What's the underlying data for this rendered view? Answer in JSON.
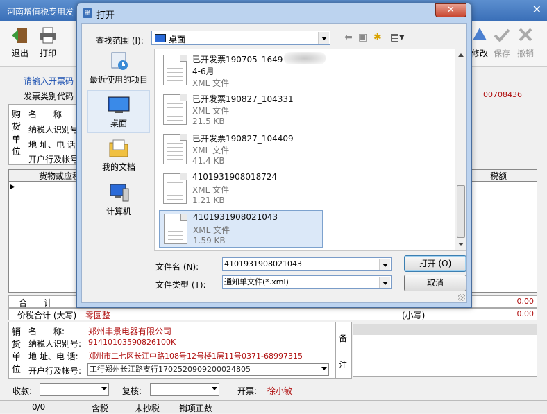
{
  "app": {
    "title": "河南增值税专用发",
    "close": "✕",
    "toolbar": {
      "exit": "退出",
      "print": "打印",
      "modify": "修改",
      "save": "保存",
      "revoke": "撤销"
    },
    "prompt": "请输入开票码",
    "ticket_type_label": "发票类别代码",
    "ticket_no": "00708436",
    "buyer": {
      "side_label": [
        "购",
        "货",
        "单",
        "位"
      ],
      "name_label": "名　　称",
      "taxid_label": "纳税人识别号",
      "addr_label": "地 址、电 话",
      "bank_label": "开户行及帐号"
    },
    "items": {
      "goods_header": "货物或应税",
      "tax_header": "税额"
    },
    "sum": {
      "label": "合　　计",
      "value": "0.00"
    },
    "total": {
      "label": "价税合计 (大写)",
      "value_text": "零圆整",
      "small_label": "(小写)",
      "small_value": "0.00"
    },
    "seller": {
      "side_label": [
        "销",
        "货",
        "单",
        "位"
      ],
      "name_label": "名　　称:",
      "name": "郑州丰景电器有限公司",
      "taxid_label": "纳税人识别号:",
      "taxid": "91410103590826100K",
      "addr_label": "地 址、电 话:",
      "addr": "郑州市二七区长江中路108号12号楼1层11号0371-68997315",
      "bank_label": "开户行及帐号:",
      "bank": "工行郑州长江路支行1702520909200024805"
    },
    "remark_label": [
      "备",
      "注"
    ],
    "payee_label": "收款:",
    "review_label": "复核:",
    "drawer_label": "开票:",
    "drawer": "徐小敏",
    "status": {
      "count": "0/0",
      "tax_mode": "含税",
      "copy_state": "未抄税",
      "sale_type": "销项正数"
    }
  },
  "dialog": {
    "title": "打开",
    "close": "✕",
    "lookin_label": "查找范围 (I):",
    "lookin_value": "桌面",
    "places": [
      {
        "label": "最近使用的项目",
        "icon": "recent-items-icon"
      },
      {
        "label": "桌面",
        "icon": "desktop-icon"
      },
      {
        "label": "我的文档",
        "icon": "my-documents-icon"
      },
      {
        "label": "计算机",
        "icon": "computer-icon"
      }
    ],
    "files": [
      {
        "name": "已开发票190705_1649",
        "type": "4-6月",
        "size": "XML 文件"
      },
      {
        "name": "已开发票190827_104331",
        "type": "XML 文件",
        "size": "21.5 KB"
      },
      {
        "name": "已开发票190827_104409",
        "type": "XML 文件",
        "size": "41.4 KB"
      },
      {
        "name": "4101931908018724",
        "type": "XML 文件",
        "size": "1.21 KB"
      },
      {
        "name": "4101931908021043",
        "type": "XML 文件",
        "size": "1.59 KB"
      }
    ],
    "filename_label": "文件名 (N):",
    "filename_value": "4101931908021043",
    "filetype_label": "文件类型 (T):",
    "filetype_value": "通知单文件(*.xml)",
    "open_button": "打开 (O)",
    "cancel_button": "取消"
  }
}
